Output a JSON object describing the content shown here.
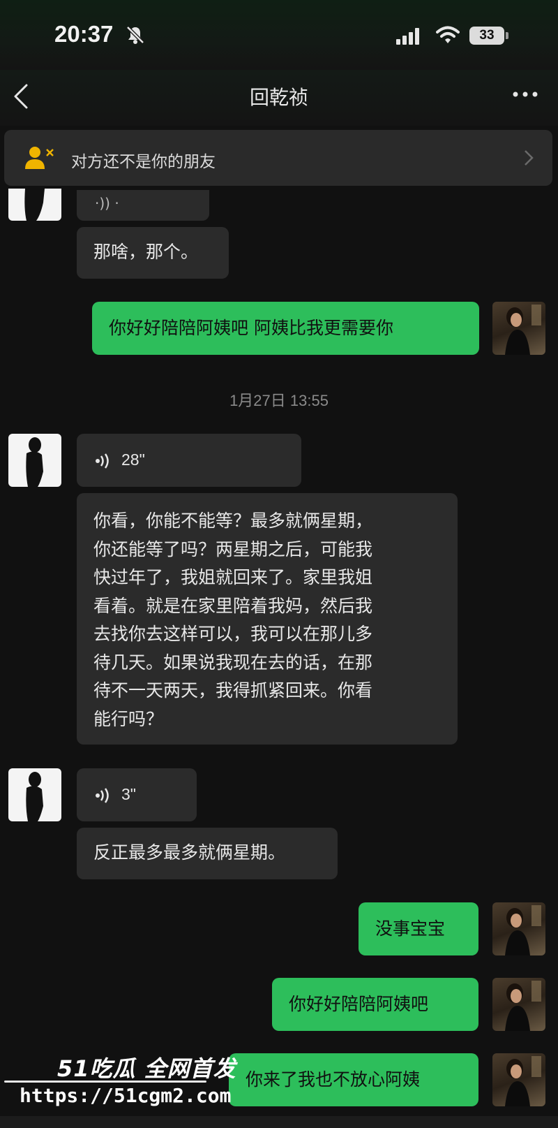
{
  "status_bar": {
    "time": "20:37",
    "battery": "33",
    "icons": [
      "bell-slash-icon",
      "signal-icon",
      "wifi-icon",
      "battery-icon"
    ]
  },
  "nav": {
    "title": "回乾祯",
    "back_icon": "chevron-left-icon",
    "more_icon": "ellipsis-icon"
  },
  "notice": {
    "text": "对方还不是你的朋友",
    "icon": "person-x-icon",
    "accent_color": "#f0b400"
  },
  "messages": {
    "m1_partial": "·)) ·",
    "m2": "那啥，那个。",
    "m3": "你好好陪陪阿姨吧 阿姨比我更需要你",
    "timestamp": "1月27日 13:55",
    "voice1": "28\"",
    "m4_lines": [
      "你看，你能不能等？最多就俩星期，",
      "你还能等了吗？两星期之后，可能我",
      "快过年了，我姐就回来了。家里我姐",
      "看着。就是在家里陪着我妈，然后我",
      "去找你去这样可以，我可以在那儿多",
      "待几天。如果说我现在去的话，在那",
      "待不一天两天，我得抓紧回来。你看",
      "能行吗？"
    ],
    "voice2": "3\"",
    "m5": "反正最多最多就俩星期。",
    "m6": "没事宝宝",
    "m7": "你好好陪陪阿姨吧",
    "m8": "你来了我也不放心阿姨"
  },
  "colors": {
    "background": "#111111",
    "incoming_bubble": "#2b2b2b",
    "outgoing_bubble": "#2dbe5b"
  },
  "watermark": {
    "brand": "51吃瓜 全网首发",
    "url": "https://51cgm2.com"
  }
}
